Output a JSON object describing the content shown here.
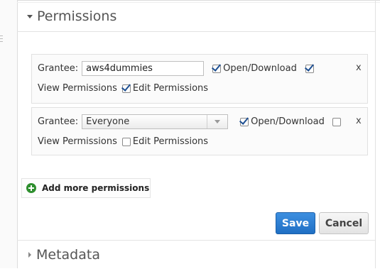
{
  "sections": {
    "permissions": {
      "title": "Permissions"
    },
    "metadata": {
      "title": "Metadata"
    }
  },
  "grants": [
    {
      "grantee_label": "Grantee:",
      "grantee_value": "aws4dummies",
      "open_download_label": "Open/Download",
      "open_download_checked": true,
      "view_permissions_label": "View Permissions",
      "view_permissions_checked": true,
      "edit_permissions_label": "Edit Permissions",
      "edit_permissions_checked": true,
      "remove_label": "x"
    },
    {
      "grantee_label": "Grantee:",
      "grantee_value": "Everyone",
      "open_download_label": "Open/Download",
      "open_download_checked": true,
      "view_permissions_label": "View Permissions",
      "view_permissions_checked": false,
      "edit_permissions_label": "Edit Permissions",
      "edit_permissions_checked": false,
      "remove_label": "x"
    }
  ],
  "actions": {
    "add_more": "Add more permissions",
    "save": "Save",
    "cancel": "Cancel"
  },
  "colors": {
    "save_button": "#2a7ad2",
    "add_icon": "#2f8f2f",
    "checkmark": "#1d4f92"
  }
}
